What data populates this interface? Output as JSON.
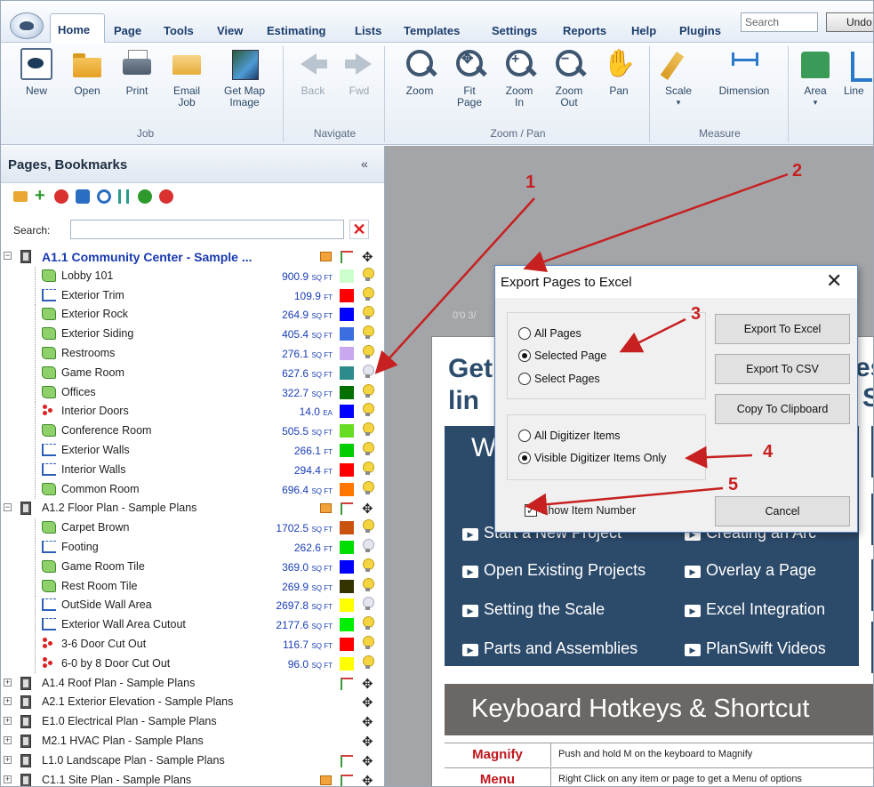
{
  "menubar": {
    "tabs": [
      "Home",
      "Page",
      "Tools",
      "View",
      "Estimating",
      "Lists",
      "Templates",
      "Settings",
      "Reports",
      "Help",
      "Plugins"
    ],
    "search_placeholder": "Search",
    "undo_label": "Undo"
  },
  "ribbon": {
    "groups": {
      "job": "Job",
      "navigate": "Navigate",
      "zoom_pan": "Zoom / Pan",
      "measure": "Measure"
    },
    "buttons": {
      "new": "New",
      "open": "Open",
      "print": "Print",
      "email_job": "Email\nJob",
      "get_map_image": "Get Map\nImage",
      "back": "Back",
      "fwd": "Fwd",
      "zoom": "Zoom",
      "fit_page": "Fit\nPage",
      "zoom_in": "Zoom\nIn",
      "zoom_out": "Zoom\nOut",
      "pan": "Pan",
      "scale": "Scale",
      "dimension": "Dimension",
      "area": "Area",
      "linear": "Line"
    }
  },
  "left_panel": {
    "title": "Pages, Bookmarks",
    "collapse": "«",
    "search_label": "Search:",
    "search_value": "",
    "clear_icon": "✕"
  },
  "tree": {
    "pages": [
      {
        "title": "A1.1 Community Center - Sample ...",
        "expanded": true,
        "active": true,
        "flags": [
          "ruler",
          "tree",
          "move"
        ],
        "items": [
          {
            "name": "Lobby 101",
            "value": "900.9",
            "unit": "SQ FT",
            "type": "area",
            "color": "#ccffcc",
            "bulb": "on"
          },
          {
            "name": "Exterior Trim",
            "value": "109.9",
            "unit": "FT",
            "type": "line",
            "color": "#ff0000",
            "bulb": "on"
          },
          {
            "name": "Exterior Rock",
            "value": "264.9",
            "unit": "SQ FT",
            "type": "area",
            "color": "#0000ff",
            "bulb": "on"
          },
          {
            "name": "Exterior Siding",
            "value": "405.4",
            "unit": "SQ FT",
            "type": "area",
            "color": "#3b6fe0",
            "bulb": "on"
          },
          {
            "name": "Restrooms",
            "value": "276.1",
            "unit": "SQ FT",
            "type": "area",
            "color": "#c9a8f0",
            "bulb": "on"
          },
          {
            "name": "Game Room",
            "value": "627.6",
            "unit": "SQ FT",
            "type": "area",
            "color": "#2e8b8b",
            "bulb": "off"
          },
          {
            "name": "Offices",
            "value": "322.7",
            "unit": "SQ FT",
            "type": "area",
            "color": "#007000",
            "bulb": "on"
          },
          {
            "name": "Interior Doors",
            "value": "14.0",
            "unit": "EA",
            "type": "count",
            "color": "#0000ff",
            "bulb": "on"
          },
          {
            "name": "Conference Room",
            "value": "505.5",
            "unit": "SQ FT",
            "type": "area",
            "color": "#66dd22",
            "bulb": "on"
          },
          {
            "name": "Exterior Walls",
            "value": "266.1",
            "unit": "FT",
            "type": "line",
            "color": "#00cc00",
            "bulb": "on"
          },
          {
            "name": "Interior Walls",
            "value": "294.4",
            "unit": "FT",
            "type": "line",
            "color": "#ff0000",
            "bulb": "on"
          },
          {
            "name": "Common Room",
            "value": "696.4",
            "unit": "SQ FT",
            "type": "area",
            "color": "#ff7700",
            "bulb": "on"
          }
        ]
      },
      {
        "title": "A1.2 Floor Plan - Sample Plans",
        "expanded": true,
        "active": false,
        "flags": [
          "ruler",
          "tree",
          "move"
        ],
        "items": [
          {
            "name": "Carpet Brown",
            "value": "1702.5",
            "unit": "SQ FT",
            "type": "area",
            "color": "#c8520e",
            "bulb": "on"
          },
          {
            "name": "Footing",
            "value": "262.6",
            "unit": "FT",
            "type": "line",
            "color": "#00dd00",
            "bulb": "off"
          },
          {
            "name": "Game Room Tile",
            "value": "369.0",
            "unit": "SQ FT",
            "type": "area",
            "color": "#0000ff",
            "bulb": "on"
          },
          {
            "name": "Rest Room Tile",
            "value": "269.9",
            "unit": "SQ FT",
            "type": "area",
            "color": "#333300",
            "bulb": "on"
          },
          {
            "name": "OutSide Wall Area",
            "value": "2697.8",
            "unit": "SQ FT",
            "type": "line",
            "color": "#ffff00",
            "bulb": "off"
          },
          {
            "name": "Exterior Wall Area Cutout",
            "value": "2177.6",
            "unit": "SQ FT",
            "type": "line",
            "color": "#00ee00",
            "bulb": "on"
          },
          {
            "name": "3-6 Door Cut Out",
            "value": "116.7",
            "unit": "SQ FT",
            "type": "count",
            "color": "#ff0000",
            "bulb": "on"
          },
          {
            "name": "6-0 by 8 Door Cut Out",
            "value": "96.0",
            "unit": "SQ FT",
            "type": "count",
            "color": "#ffff00",
            "bulb": "on"
          }
        ]
      },
      {
        "title": "A1.4 Roof Plan - Sample Plans",
        "expanded": false,
        "flags": [
          "tree",
          "move"
        ],
        "items": []
      },
      {
        "title": "A2.1 Exterior Elevation - Sample Plans",
        "expanded": false,
        "flags": [
          "move"
        ],
        "items": []
      },
      {
        "title": "E1.0 Electrical Plan - Sample Plans",
        "expanded": false,
        "flags": [
          "move"
        ],
        "items": []
      },
      {
        "title": "M2.1 HVAC Plan - Sample Plans",
        "expanded": false,
        "flags": [
          "move"
        ],
        "items": []
      },
      {
        "title": "L1.0 Landscape Plan - Sample Plans",
        "expanded": false,
        "flags": [
          "tree",
          "move"
        ],
        "items": []
      },
      {
        "title": "C1.1 Site Plan - Sample Plans",
        "expanded": false,
        "flags": [
          "ruler",
          "tree",
          "move"
        ],
        "items": []
      }
    ]
  },
  "canvas": {
    "coord_text": "0'0 3/",
    "doc": {
      "heading_line1": "Get",
      "heading_line2": "lin",
      "heading_right1": "es",
      "heading_right2": "S",
      "panel_letter": "W",
      "links_left": [
        "Start a New Project",
        "Open Existing Projects",
        "Setting the Scale",
        "Parts and Assemblies"
      ],
      "links_right": [
        "Creating an Arc",
        "Overlay a Page",
        "Excel Integration",
        "PlanSwift Videos"
      ],
      "kb_title": "Keyboard Hotkeys & Shortcut",
      "kb_rows": [
        {
          "key": "Magnify",
          "desc": "Push and hold M on the keyboard to Magnify"
        },
        {
          "key": "Menu",
          "desc": "Right Click on any item or page to get a Menu of options"
        }
      ]
    }
  },
  "dialog": {
    "title": "Export Pages to Excel",
    "close": "✕",
    "pages_options": [
      "All Pages",
      "Selected Page",
      "Select Pages"
    ],
    "pages_selected": 1,
    "items_options": [
      "All Digitizer Items",
      "Visible Digitizer Items Only"
    ],
    "items_selected": 1,
    "show_item_number_label": "Show Item Number",
    "show_item_number_checked": true,
    "buttons": {
      "export_excel": "Export To Excel",
      "export_csv": "Export To CSV",
      "copy_clipboard": "Copy To Clipboard",
      "cancel": "Cancel"
    }
  },
  "annotations": {
    "labels": [
      "1",
      "2",
      "3",
      "4",
      "5"
    ],
    "color": "#c72020"
  }
}
